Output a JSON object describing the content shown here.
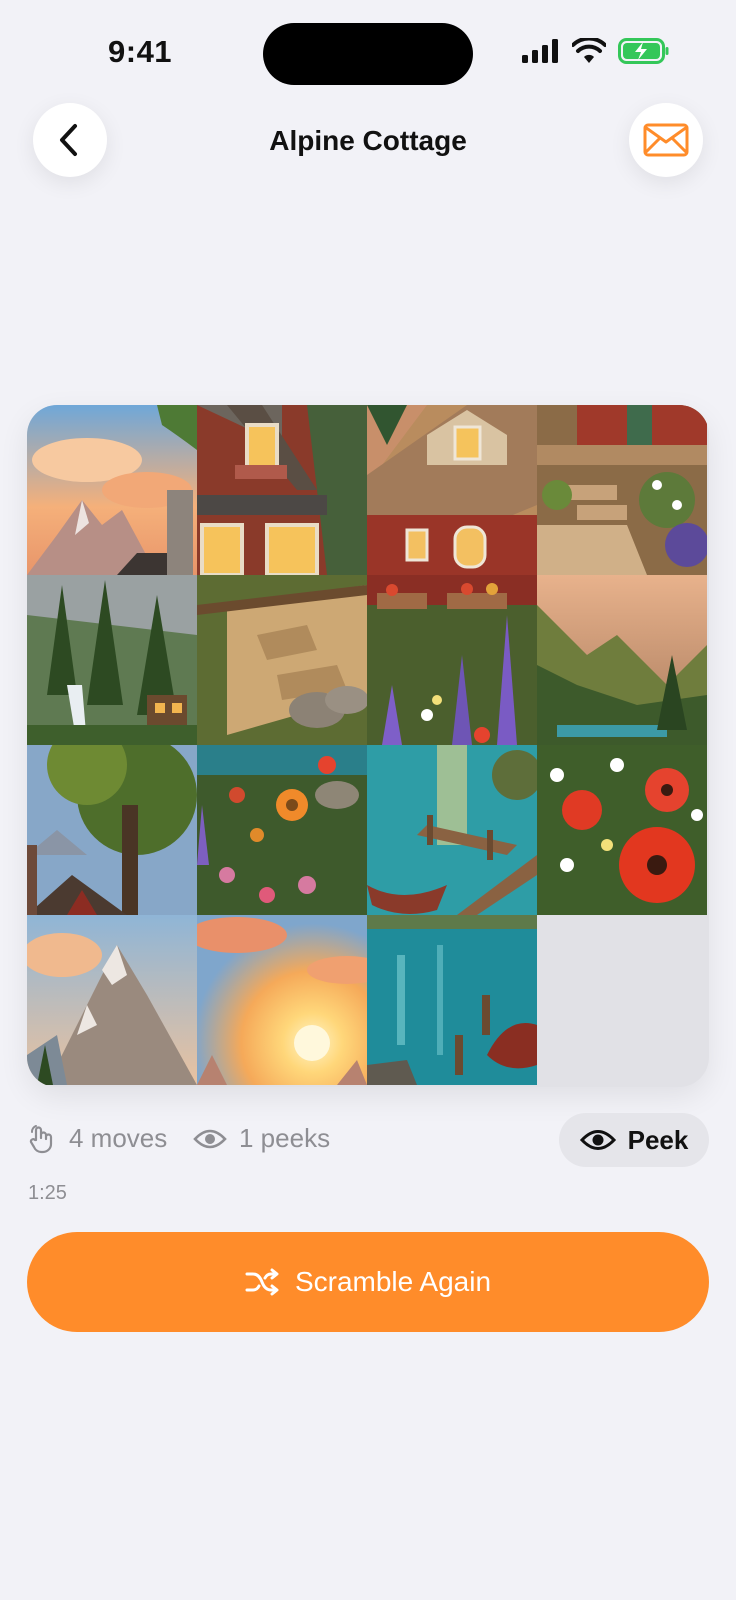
{
  "status_bar": {
    "time": "9:41"
  },
  "nav": {
    "title": "Alpine Cottage",
    "back_icon": "chevron-left-icon",
    "mail_icon": "envelope-icon"
  },
  "puzzle": {
    "grid": "4x4",
    "empty_slot": 16,
    "tiles": [
      {
        "description": "sunset-clouds-mountain-peak"
      },
      {
        "description": "red-house-window"
      },
      {
        "description": "red-house-roof-window"
      },
      {
        "description": "porch-steps-flowers"
      },
      {
        "description": "forest-waterfall-cabin"
      },
      {
        "description": "stone-path"
      },
      {
        "description": "flower-boxes-lupines"
      },
      {
        "description": "mountain-valley-lake"
      },
      {
        "description": "tree-roof-mountains"
      },
      {
        "description": "wildflowers"
      },
      {
        "description": "lake-dock-boat"
      },
      {
        "description": "red-poppies-daisies"
      },
      {
        "description": "rocky-mountain-peak"
      },
      {
        "description": "sunset-sky"
      },
      {
        "description": "water-boat"
      }
    ]
  },
  "stats": {
    "moves": "4 moves",
    "peeks": "1 peeks",
    "timer": "1:25"
  },
  "peek_button": {
    "label": "Peek"
  },
  "scramble_button": {
    "label": "Scramble Again"
  },
  "colors": {
    "accent": "#FF8C2A",
    "background": "#F2F2F7",
    "secondary_text": "#8E8E93",
    "battery": "#34C759"
  }
}
